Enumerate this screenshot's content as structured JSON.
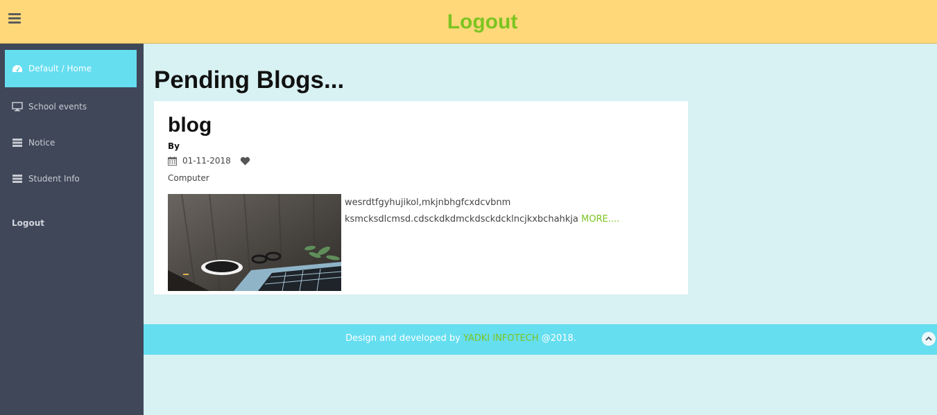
{
  "header": {
    "title": "Logout",
    "menu_icon": "hamburger-icon"
  },
  "sidebar": {
    "items": [
      {
        "label": "Default / Home",
        "icon": "dashboard-icon",
        "active": true
      },
      {
        "label": "School events",
        "icon": "monitor-icon"
      },
      {
        "label": "Notice",
        "icon": "list-icon"
      },
      {
        "label": "Student Info",
        "icon": "list-icon"
      }
    ],
    "logout_label": "Logout"
  },
  "main": {
    "heading": "Pending Blogs...",
    "blog": {
      "title": "blog",
      "by": "By",
      "date": "01-11-2018",
      "category": "Computer",
      "text_line1": "wesrdtfgyhujikol,mkjnbhgfcxdcvbnm",
      "text_line2": "ksmcksdlcmsd.cdsckdkdmckdsckdcklncjkxbchahkja",
      "more_label": "MORE...."
    }
  },
  "footer": {
    "prefix": "Design and developed by",
    "brand": "YADKI INFOTECH",
    "suffix": "@2018."
  },
  "colors": {
    "topbar": "#ffd87a",
    "accent_green": "#7cc421",
    "sidebar_bg": "#3f4759",
    "active_cyan": "#65def0",
    "page_bg": "#d8f1f2"
  }
}
